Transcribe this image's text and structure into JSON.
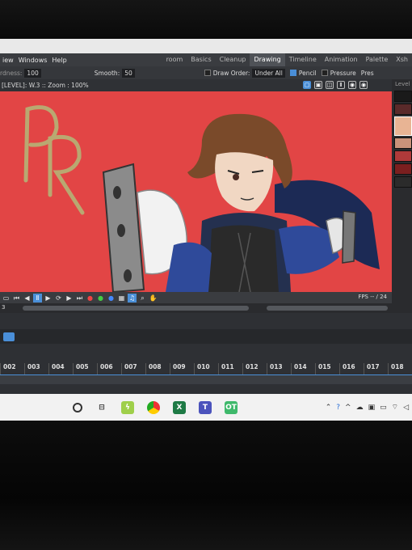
{
  "menu": [
    "iew",
    "Windows",
    "Help"
  ],
  "rooms": [
    "room",
    "Basics",
    "Cleanup",
    "Drawing",
    "Timeline",
    "Animation",
    "Palette",
    "Xsh"
  ],
  "active_room": "Drawing",
  "tool_options": {
    "hardness_label": "rdness:",
    "hardness_value": "100",
    "smooth_label": "Smooth:",
    "smooth_value": "50",
    "draw_order_label": "Draw Order:",
    "draw_order_value": "Under All",
    "pencil_label": "Pencil",
    "pressure_label": "Pressure",
    "pres_label": "Pres"
  },
  "viewer": {
    "title": "[LEVEL]: W.3  ::  Zoom : 100%",
    "level_strip_label": "Level"
  },
  "canvas": {
    "background": "#e24545",
    "letters": "PR"
  },
  "level_colors": [
    "#1a1a1a",
    "#5a2a2a",
    "#e8b494",
    "#c9927a",
    "#b03a3a",
    "#7a1f1f",
    "#2b2b2b"
  ],
  "transport": {
    "fps_text": "FPS -- / 24"
  },
  "scroll": {
    "frame_label": "3"
  },
  "frames": [
    "002",
    "003",
    "004",
    "005",
    "006",
    "007",
    "008",
    "009",
    "010",
    "011",
    "012",
    "013",
    "014",
    "015",
    "016",
    "017",
    "018"
  ],
  "taskbar": {
    "apps": [
      "",
      "",
      "",
      "",
      "X",
      "T",
      "OT"
    ],
    "tray_icons": [
      "^",
      "?",
      "^",
      "",
      "",
      "",
      "",
      ""
    ]
  }
}
